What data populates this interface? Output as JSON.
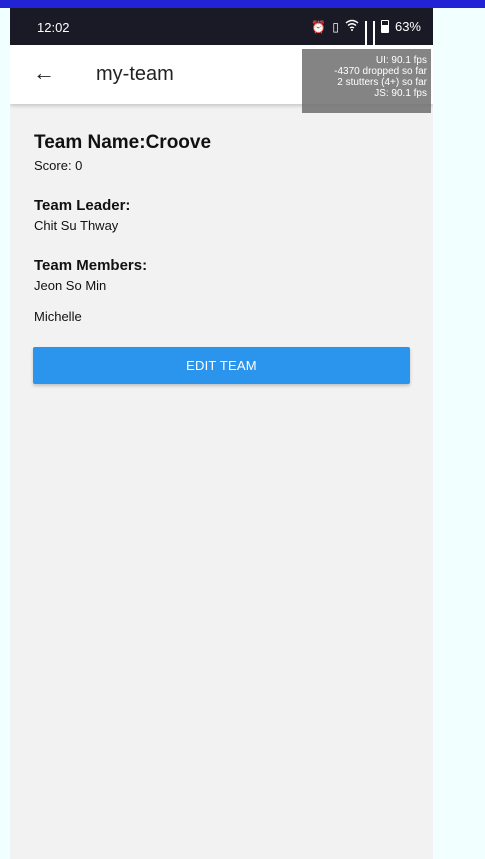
{
  "status_bar": {
    "time": "12:02",
    "battery_percent": "63%",
    "icons": [
      "alarm-icon",
      "vibrate-icon",
      "wifi-icon",
      "signal-icon",
      "signal-icon",
      "battery-icon"
    ]
  },
  "app_bar": {
    "back_icon": "arrow-left-icon",
    "title": "my-team"
  },
  "perf_overlay": {
    "ui_fps": "UI: 90.1 fps",
    "dropped": "-4370 dropped so far",
    "stutters": "2 stutters (4+) so far",
    "js_fps": "JS: 90.1 fps"
  },
  "team": {
    "name_label": "Team Name:Croove",
    "score_label": "Score: 0",
    "leader_heading": "Team Leader:",
    "leader_name": "Chit Su Thway",
    "members_heading": "Team Members:",
    "members": [
      "Jeon So Min",
      "Michelle"
    ]
  },
  "actions": {
    "edit_label": "EDIT TEAM"
  },
  "colors": {
    "primary_button": "#2b95ee",
    "status_bar": "#1a1a26",
    "screen_background": "#f2f2f2",
    "top_strip": "#2323d6"
  }
}
